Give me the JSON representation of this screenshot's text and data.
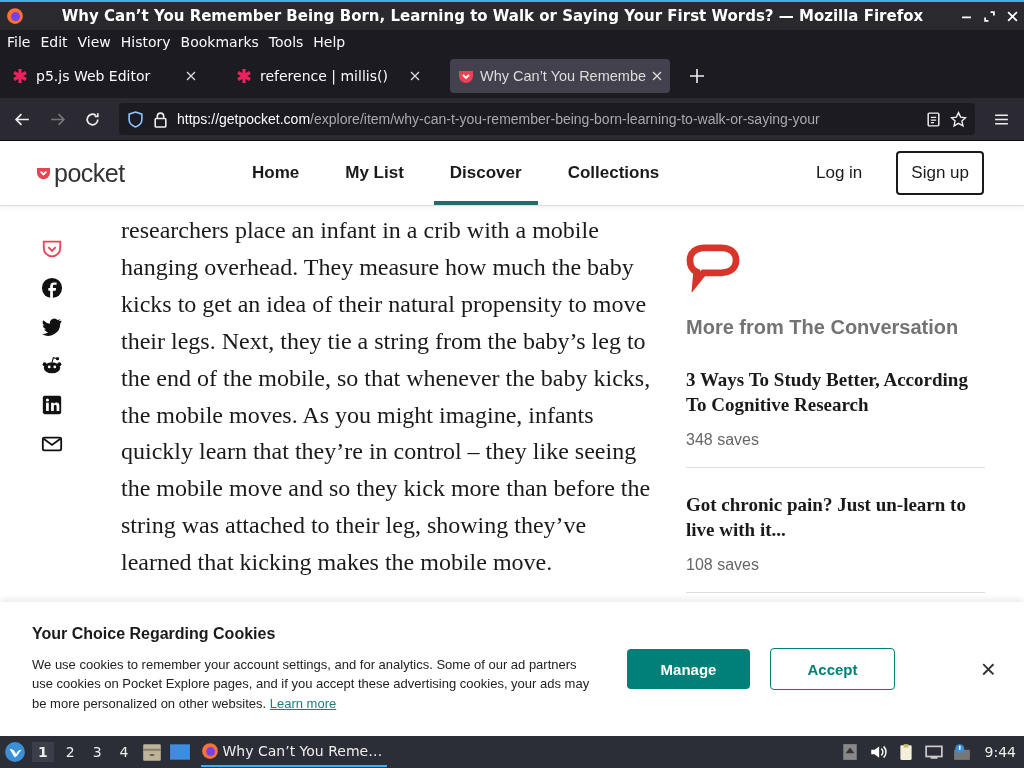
{
  "window": {
    "title": "Why Can’t You Remember Being Born, Learning to Walk or Saying Your First Words? — Mozilla Firefox"
  },
  "menu": [
    "File",
    "Edit",
    "View",
    "History",
    "Bookmarks",
    "Tools",
    "Help"
  ],
  "tabs": [
    {
      "label": "p5.js Web Editor",
      "kind": "asterisk",
      "selected": false
    },
    {
      "label": "reference | millis()",
      "kind": "asterisk",
      "selected": false
    },
    {
      "label": "Why Can’t You Remembe",
      "kind": "pocket",
      "selected": true
    }
  ],
  "url": {
    "host": "https://getpocket.com",
    "path": "/explore/item/why-can-t-you-remember-being-born-learning-to-walk-or-saying-your"
  },
  "site": {
    "logo": "pocket",
    "nav": [
      {
        "label": "Home",
        "selected": false
      },
      {
        "label": "My List",
        "selected": false
      },
      {
        "label": "Discover",
        "selected": true
      },
      {
        "label": "Collections",
        "selected": false
      }
    ],
    "login": "Log in",
    "signup": "Sign up"
  },
  "share": [
    {
      "kind": "pocket"
    },
    {
      "kind": "facebook"
    },
    {
      "kind": "twitter"
    },
    {
      "kind": "reddit"
    },
    {
      "kind": "linkedin"
    },
    {
      "kind": "email"
    }
  ],
  "article": "researchers place an infant in a crib with a mobile hanging overhead. They measure how much the baby kicks to get an idea of their natural propensity to move their legs. Next, they tie a string from the baby’s leg to the end of the mobile, so that whenever the baby kicks, the mobile moves. As you might imagine, infants quickly learn that they’re in control – they like seeing the mobile move and so they kick more than before the string was attached to their leg, showing they’ve learned that kicking makes the mobile move.",
  "sidebar": {
    "heading": "More from The Conversation",
    "items": [
      {
        "title": "3 Ways To Study Better, According To Cognitive Research",
        "saves": "348 saves"
      },
      {
        "title": "Got chronic pain? Just un-learn to live with it...",
        "saves": "108 saves"
      }
    ]
  },
  "cookies": {
    "title": "Your Choice Regarding Cookies",
    "text": "We use cookies to remember your account settings, and for analytics. Some of our ad partners use cookies on Pocket Explore pages, and if you accept these advertising cookies, your ads may be more personalized on other websites.",
    "link": "Learn more",
    "manage": "Manage",
    "accept": "Accept",
    "close": "×"
  },
  "taskbar": {
    "workspaces": [
      {
        "label": "1",
        "selected": true
      },
      {
        "label": "2",
        "selected": false
      },
      {
        "label": "3",
        "selected": false
      },
      {
        "label": "4",
        "selected": false
      }
    ],
    "window": "Why Can’t You Reme…",
    "clock": "9:44"
  }
}
